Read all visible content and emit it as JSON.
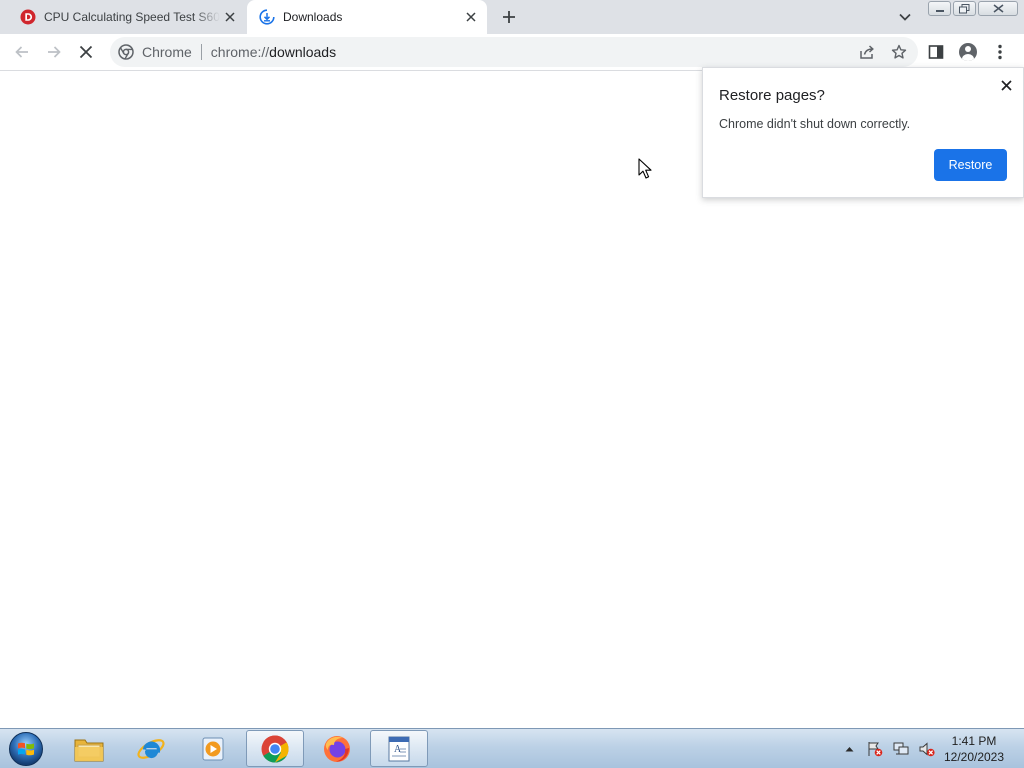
{
  "browser": {
    "tabs": [
      {
        "title": "CPU Calculating Speed Test S60 S",
        "favicon": "dcode-icon",
        "active": false
      },
      {
        "title": "Downloads",
        "favicon": "chrome-downloads-icon",
        "active": true
      }
    ],
    "omnibox": {
      "origin_label": "Chrome",
      "url_scheme": "chrome://",
      "url_path": "downloads"
    }
  },
  "restore_bubble": {
    "title": "Restore pages?",
    "message": "Chrome didn't shut down correctly.",
    "restore_label": "Restore"
  },
  "taskbar": {
    "apps": [
      "file-explorer-icon",
      "internet-explorer-icon",
      "media-player-icon",
      "chrome-icon",
      "firefox-icon",
      "document-app-icon"
    ],
    "clock": {
      "time": "1:41 PM",
      "date": "12/20/2023"
    }
  },
  "colors": {
    "accent": "#1a73e8",
    "tabstrip": "#dee1e6",
    "omnibox": "#f1f3f4"
  }
}
